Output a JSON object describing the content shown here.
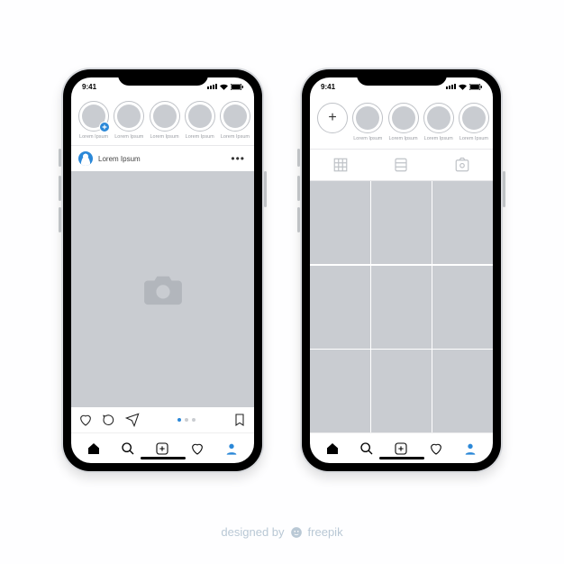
{
  "colors": {
    "accent": "#2b88d8",
    "placeholder": "#c9ccd1",
    "muted": "#9a9da3"
  },
  "status": {
    "time": "9:41"
  },
  "feed": {
    "stories": [
      {
        "label": "Lorem Ipsum",
        "has_plus_badge": true
      },
      {
        "label": "Lorem Ipsum"
      },
      {
        "label": "Lorem Ipsum"
      },
      {
        "label": "Lorem Ipsum"
      },
      {
        "label": "Lorem Ipsum"
      }
    ],
    "post": {
      "author": "Lorem Ipsum",
      "carousel_index": 0,
      "carousel_total": 3
    }
  },
  "profile": {
    "highlights": [
      {
        "label": "Lorem Ipsum"
      },
      {
        "label": "Lorem Ipsum"
      },
      {
        "label": "Lorem Ipsum"
      },
      {
        "label": "Lorem Ipsum"
      }
    ],
    "grid_items": 9
  },
  "credit": {
    "prefix": "designed by",
    "brand": "freepik"
  }
}
